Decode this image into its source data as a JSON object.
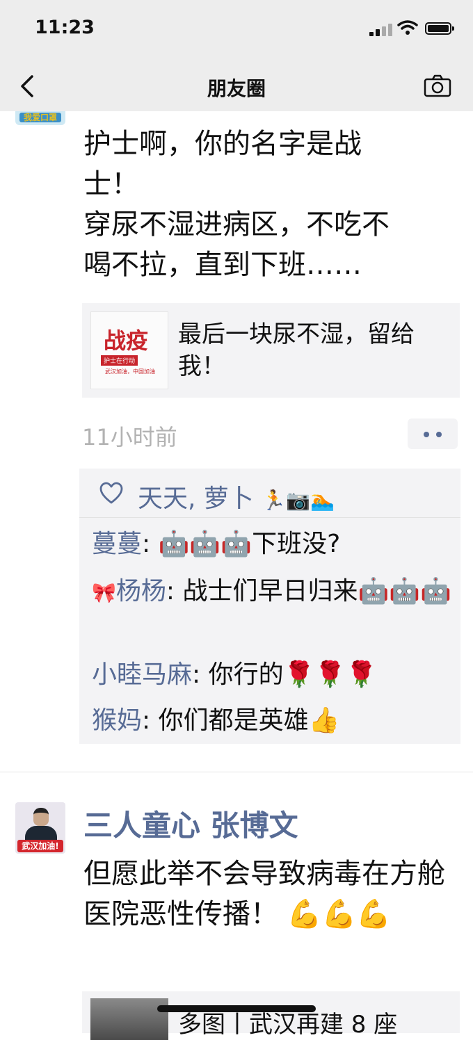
{
  "status_bar": {
    "time": "11:23"
  },
  "nav": {
    "title": "朋友圈"
  },
  "avatar_top": {
    "badge_text": "我爱口罩"
  },
  "post1": {
    "text": "护士啊，你的名字是战\n士！\n穿尿不湿进病区，不吃不\n喝不拉，直到下班……",
    "link_card": {
      "thumb_main": "战疫",
      "thumb_sub": "护士在行动",
      "thumb_foot": "武汉加油，中国加油",
      "title": "最后一块尿不湿，留给我！"
    },
    "time": "11小时前",
    "likes": {
      "names": "天天, 萝卜",
      "emojis": "🏃📷🏊"
    },
    "comments": [
      {
        "name": "蔓蔓",
        "prefix": "",
        "text": "🤖🤖🤖下班没?"
      },
      {
        "name": "杨杨",
        "prefix": "🎀",
        "text": "战士们早日归来🤖🤖🤖"
      },
      {
        "name": "小睦马麻",
        "prefix": "",
        "text": "你行的🌹🌹🌹"
      },
      {
        "name": "猴妈",
        "prefix": "",
        "text": "你们都是英雄👍"
      }
    ]
  },
  "post2": {
    "author": "三人童心 张博文",
    "avatar_banner": "武汉加油!",
    "text": "但愿此举不会导致病毒在方舱医院恶性传播！ 💪💪💪",
    "link_title": "多图丨武汉再建 8 座"
  }
}
